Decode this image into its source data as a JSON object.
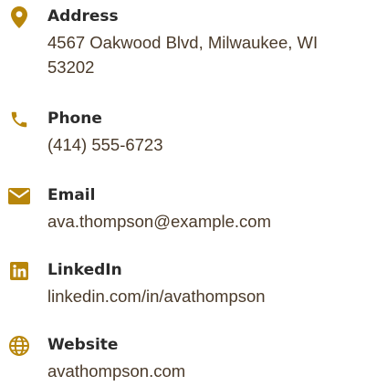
{
  "accent_color": "#b8860b",
  "contacts": [
    {
      "icon": "map-pin-icon",
      "label": "Address",
      "value": "4567 Oakwood Blvd, Milwaukee, WI 53202"
    },
    {
      "icon": "phone-icon",
      "label": "Phone",
      "value": "(414) 555-6723"
    },
    {
      "icon": "envelope-icon",
      "label": "Email",
      "value": "ava.thompson@example.com"
    },
    {
      "icon": "linkedin-icon",
      "label": "LinkedIn",
      "value": "linkedin.com/in/avathompson"
    },
    {
      "icon": "globe-icon",
      "label": "Website",
      "value": "avathompson.com"
    }
  ]
}
